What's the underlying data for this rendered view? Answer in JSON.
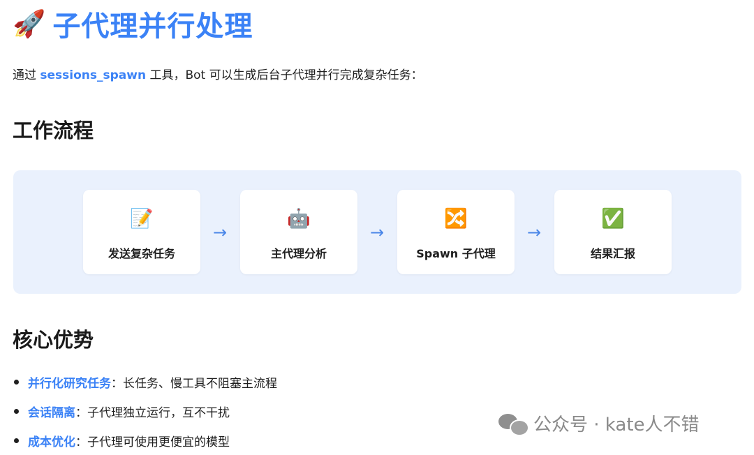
{
  "header": {
    "icon": "🚀",
    "icon_name": "rocket-icon",
    "title": "子代理并行处理"
  },
  "intro": {
    "prefix": "通过 ",
    "keyword": "sessions_spawn",
    "suffix": " 工具，Bot 可以生成后台子代理并行完成复杂任务："
  },
  "workflow": {
    "title": "工作流程",
    "steps": [
      {
        "icon": "📝",
        "icon_name": "memo-icon",
        "label": "发送复杂任务"
      },
      {
        "icon": "🤖",
        "icon_name": "robot-icon",
        "label": "主代理分析"
      },
      {
        "icon": "🔀",
        "icon_name": "shuffle-icon",
        "label": "Spawn 子代理"
      },
      {
        "icon": "✅",
        "icon_name": "check-mark-icon",
        "label": "结果汇报"
      }
    ],
    "arrow": "→"
  },
  "advantages": {
    "title": "核心优势",
    "items": [
      {
        "term": "并行化研究任务",
        "desc": "：长任务、慢工具不阻塞主流程"
      },
      {
        "term": "会话隔离",
        "desc": "：子代理独立运行，互不干扰"
      },
      {
        "term": "成本优化",
        "desc": "：子代理可使用更便宜的模型"
      }
    ]
  },
  "watermark": {
    "icon_name": "wechat-icon",
    "text": "公众号 · kate人不错"
  },
  "colors": {
    "accent": "#3b82f6",
    "panel_bg": "#eaf1fd",
    "arrow": "#4a86e8"
  }
}
